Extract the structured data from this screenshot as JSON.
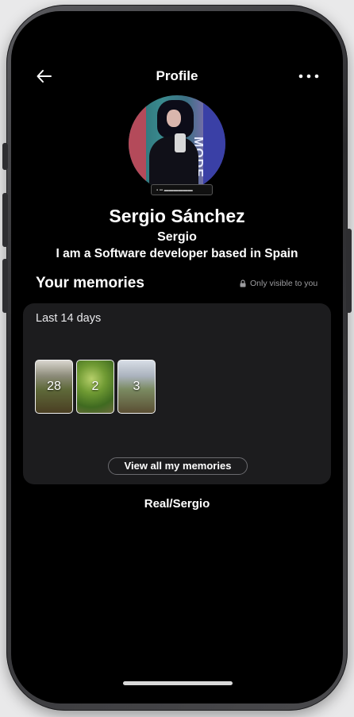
{
  "header": {
    "title": "Profile"
  },
  "icons": {
    "back": "arrow-left-icon",
    "more": "more-horizontal-icon",
    "lock": "lock-icon"
  },
  "profile": {
    "avatar_overlay_text": "MODE",
    "full_name": "Sergio Sánchez",
    "username": "Sergio",
    "bio": "I am a Software developer based in Spain"
  },
  "memories": {
    "heading": "Your memories",
    "visibility_label": "Only visible to you",
    "range_label": "Last 14 days",
    "items": [
      {
        "day": "28"
      },
      {
        "day": "2"
      },
      {
        "day": "3"
      }
    ],
    "view_all_label": "View all my memories"
  },
  "footer": {
    "handle": "Real/Sergio"
  },
  "colors": {
    "background": "#000000",
    "card": "#1c1c1e",
    "muted_text": "#9c9c9f"
  }
}
